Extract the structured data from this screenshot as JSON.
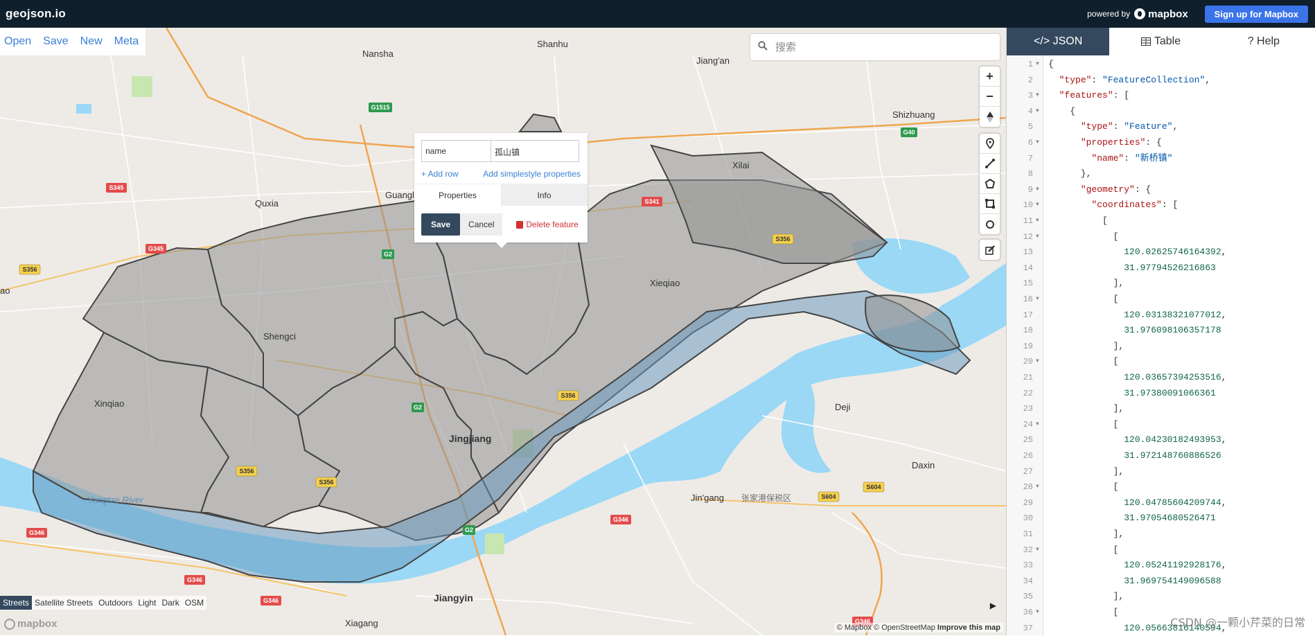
{
  "app": {
    "logo": "geojson.io",
    "powered_by": "powered by",
    "mapbox_brand": "mapbox",
    "signup_label": "Sign up for Mapbox"
  },
  "file_menu": {
    "open": "Open",
    "save": "Save",
    "new": "New",
    "meta": "Meta"
  },
  "search": {
    "placeholder": "搜索"
  },
  "map_controls": {
    "zoom_in": "+",
    "zoom_out": "−"
  },
  "popup": {
    "property_key": "name",
    "property_value": "孤山镇",
    "add_row": "+ Add row",
    "add_simplestyle": "Add simplestyle properties",
    "tab_properties": "Properties",
    "tab_info": "Info",
    "save": "Save",
    "cancel": "Cancel",
    "delete": "Delete feature"
  },
  "map_labels": {
    "shanhu": "Shanhu",
    "nansha": "Nansha",
    "jiangan": "Jiang'an",
    "shizhuang": "Shizhuang",
    "xilai": "Xilai",
    "quxia": "Quxia",
    "guangl": "Guangl",
    "shengci": "Shengci",
    "xieqiao": "Xieqiao",
    "xinqiao": "Xinqiao",
    "jingjiang": "Jingjiang",
    "deji": "Deji",
    "daxin": "Daxin",
    "yangtze": "Yangtze River",
    "jingang": "Jin'gang",
    "bonded": "张家港保税区",
    "jiangyin": "Jiangyin",
    "xiagang": "Xiagang",
    "ao": "ao",
    "shields": {
      "g1515": "G1515",
      "g40": "G40",
      "s345": "S345",
      "g345": "G345",
      "s356a": "S356",
      "s356b": "S356",
      "s356c": "S356",
      "s356d": "S356",
      "s356e": "S356",
      "g2a": "G2",
      "g2b": "G2",
      "g2c": "G2",
      "s341": "S341",
      "g346a": "G346",
      "g346b": "G346",
      "g346c": "G346",
      "g346d": "G346",
      "g346e": "G346",
      "s604a": "S604",
      "s604b": "S604"
    }
  },
  "style_switcher": [
    "Streets",
    "Satellite Streets",
    "Outdoors",
    "Light",
    "Dark",
    "OSM"
  ],
  "attribution": {
    "mapbox": "© Mapbox",
    "osm": "© OpenStreetMap",
    "improve": "Improve this map"
  },
  "watermark_logo": "mapbox",
  "panel_tabs": [
    {
      "label": "</> JSON",
      "active": true
    },
    {
      "label": "Table",
      "active": false
    },
    {
      "label": "? Help",
      "active": false
    }
  ],
  "code_lines": [
    "{",
    "  \"type\": \"FeatureCollection\",",
    "  \"features\": [",
    "    {",
    "      \"type\": \"Feature\",",
    "      \"properties\": {",
    "        \"name\": \"新桥镇\"",
    "      },",
    "      \"geometry\": {",
    "        \"coordinates\": [",
    "          [",
    "            [",
    "              120.02625746164392,",
    "              31.97794526216863",
    "            ],",
    "            [",
    "              120.03138321077012,",
    "              31.976098106357178",
    "            ],",
    "            [",
    "              120.03657394253516,",
    "              31.97380091066361",
    "            ],",
    "            [",
    "              120.04230182493953,",
    "              31.972148760886526",
    "            ],",
    "            [",
    "              120.04785604209744,",
    "              31.97054680526471",
    "            ],",
    "            [",
    "              120.05241192928176,",
    "              31.969754149096588",
    "            ],",
    "            [",
    "              120.05663816140594,"
  ],
  "foldable_lines": [
    1,
    3,
    4,
    6,
    9,
    10,
    11,
    12,
    16,
    20,
    24,
    28,
    32,
    36
  ],
  "csdn_watermark": "CSDN @一颗小芹菜的日常"
}
